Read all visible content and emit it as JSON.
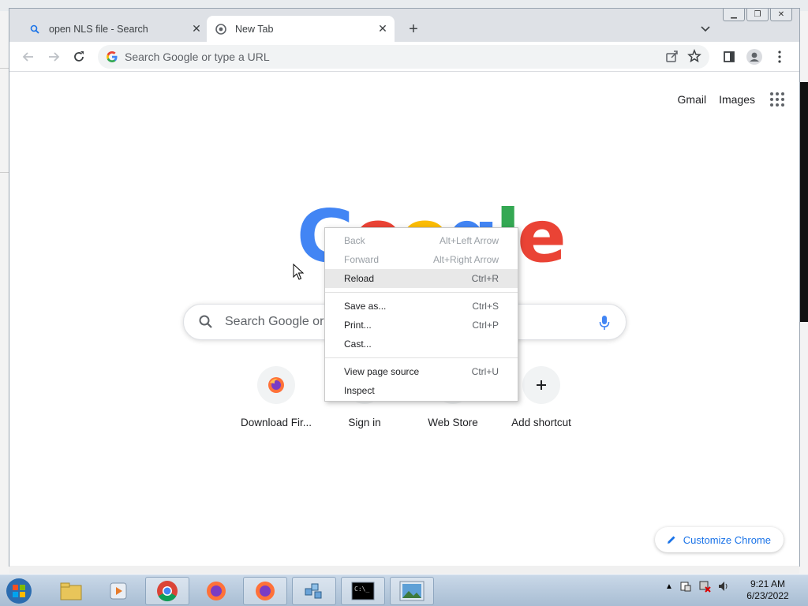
{
  "tabs": [
    {
      "title": "open NLS file - Search",
      "active": false
    },
    {
      "title": "New Tab",
      "active": true
    }
  ],
  "omnibox": {
    "placeholder": "Search Google or type a URL"
  },
  "ntp": {
    "links": {
      "gmail": "Gmail",
      "images": "Images"
    },
    "logo": [
      "G",
      "o",
      "o",
      "g",
      "l",
      "e"
    ],
    "logo_colors": [
      "#4285f4",
      "#ea4335",
      "#fbbc05",
      "#4285f4",
      "#34a853",
      "#ea4335"
    ],
    "search_placeholder": "Search Google or type a URL",
    "search_placeholder_visible": "Search Google or t",
    "shortcuts": [
      {
        "label": "Download Fir...",
        "icon": "firefox-icon"
      },
      {
        "label": "Sign in",
        "icon": "sign-in-icon"
      },
      {
        "label": "Web Store",
        "icon": "web-store-icon"
      },
      {
        "label": "Add shortcut",
        "icon": "plus-icon"
      }
    ],
    "customize": "Customize Chrome"
  },
  "context_menu": {
    "groups": [
      [
        {
          "label": "Back",
          "shortcut": "Alt+Left Arrow",
          "disabled": true
        },
        {
          "label": "Forward",
          "shortcut": "Alt+Right Arrow",
          "disabled": true
        },
        {
          "label": "Reload",
          "shortcut": "Ctrl+R",
          "disabled": false,
          "highlighted": true
        }
      ],
      [
        {
          "label": "Save as...",
          "shortcut": "Ctrl+S",
          "disabled": false
        },
        {
          "label": "Print...",
          "shortcut": "Ctrl+P",
          "disabled": false
        },
        {
          "label": "Cast...",
          "shortcut": "",
          "disabled": false
        }
      ],
      [
        {
          "label": "View page source",
          "shortcut": "Ctrl+U",
          "disabled": false
        },
        {
          "label": "Inspect",
          "shortcut": "",
          "disabled": false
        }
      ]
    ]
  },
  "taskbar": {
    "items": [
      "windows-explorer-icon",
      "media-player-icon",
      "chrome-icon",
      "firefox-icon",
      "firefox-icon",
      "network-icon",
      "cmd-icon",
      "picture-viewer-icon"
    ],
    "clock": {
      "time": "9:21 AM",
      "date": "6/23/2022"
    }
  },
  "colors": {
    "accent": "#1a73e8",
    "tabstrip": "#dee1e6",
    "menu_highlight": "#e8e8e8"
  }
}
